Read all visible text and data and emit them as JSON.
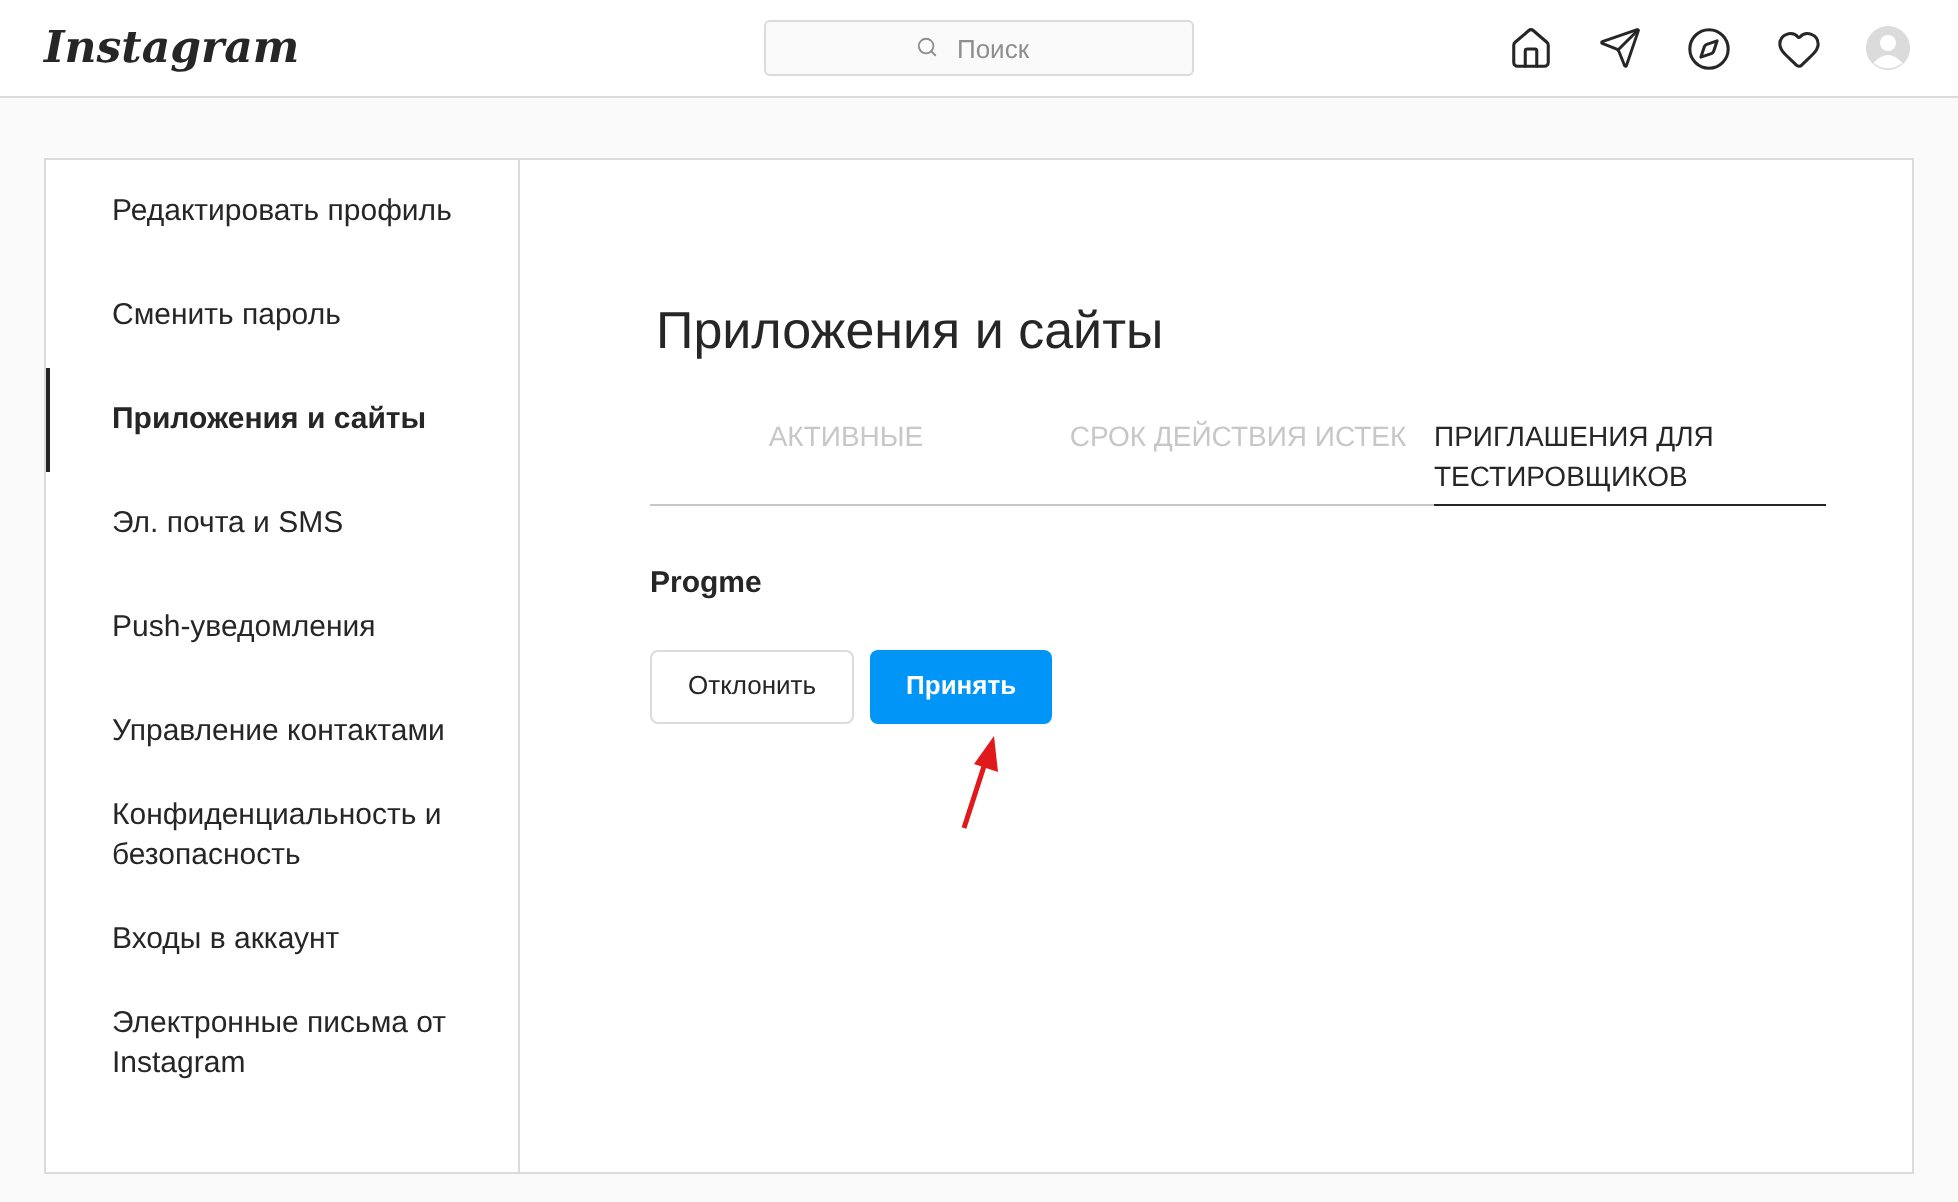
{
  "header": {
    "logo": "Instagram",
    "search": {
      "placeholder": "Поиск"
    }
  },
  "sidebar": {
    "items": [
      {
        "label": "Редактировать профиль",
        "selected": false
      },
      {
        "label": "Сменить пароль",
        "selected": false
      },
      {
        "label": "Приложения и сайты",
        "selected": true
      },
      {
        "label": "Эл. почта и SMS",
        "selected": false
      },
      {
        "label": "Push-уведомления",
        "selected": false
      },
      {
        "label": "Управление контактами",
        "selected": false
      },
      {
        "label": "Конфиденциальность и безопасность",
        "selected": false
      },
      {
        "label": "Входы в аккаунт",
        "selected": false
      },
      {
        "label": "Электронные письма от Instagram",
        "selected": false
      }
    ]
  },
  "content": {
    "title": "Приложения и сайты",
    "tabs": [
      {
        "label": "АКТИВНЫЕ",
        "selected": false
      },
      {
        "label": "СРОК ДЕЙСТВИЯ ИСТЕК",
        "selected": false
      },
      {
        "label": "ПРИГЛАШЕНИЯ ДЛЯ ТЕСТИРОВЩИКОВ",
        "selected": true
      }
    ],
    "invite": {
      "app": "Progme",
      "buttons": [
        {
          "label": "Отклонить",
          "kind": "secondary"
        },
        {
          "label": "Принять",
          "kind": "primary"
        }
      ]
    }
  }
}
